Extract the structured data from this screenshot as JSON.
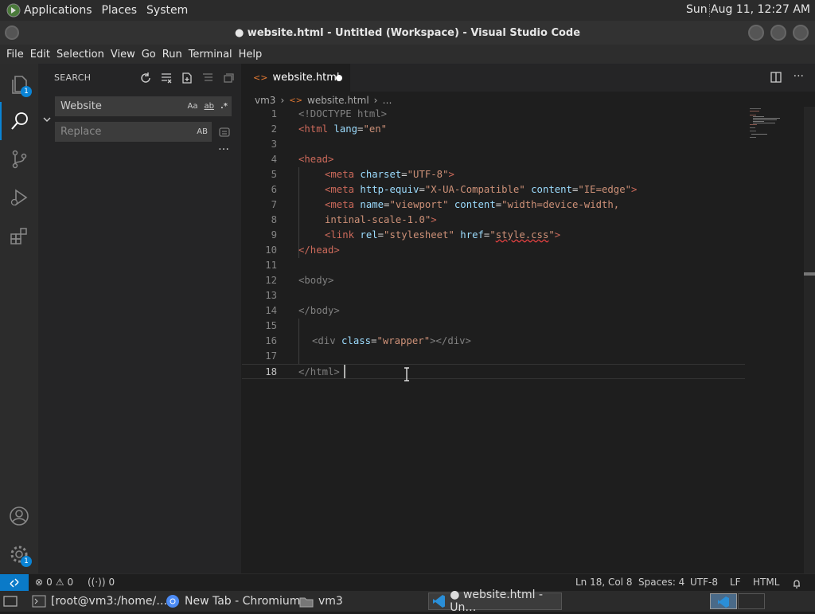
{
  "topbar": {
    "applications": "Applications",
    "places": "Places",
    "system": "System",
    "clock": "Sun Aug 11, 12:27 AM"
  },
  "window": {
    "title": "● website.html - Untitled (Workspace) - Visual Studio Code"
  },
  "menu": [
    "File",
    "Edit",
    "Selection",
    "View",
    "Go",
    "Run",
    "Terminal",
    "Help"
  ],
  "activity": {
    "explorer_badge": "1",
    "settings_badge": "1"
  },
  "sidebar": {
    "title": "SEARCH",
    "search_value": "Website",
    "replace_placeholder": "Replace",
    "opt_case": "Aa",
    "opt_word": "ab",
    "opt_regex": ".*",
    "opt_preserve": "AB",
    "more": "…"
  },
  "editor": {
    "tab_label": "website.html",
    "breadcrumb": [
      "vm3",
      "website.html",
      "…"
    ],
    "lines": [
      {
        "n": "1"
      },
      {
        "n": "2"
      },
      {
        "n": "3"
      },
      {
        "n": "4"
      },
      {
        "n": "5"
      },
      {
        "n": "6"
      },
      {
        "n": "7"
      },
      {
        "n": "8"
      },
      {
        "n": "9"
      },
      {
        "n": "10"
      },
      {
        "n": "11"
      },
      {
        "n": "12"
      },
      {
        "n": "13"
      },
      {
        "n": "14"
      },
      {
        "n": "15"
      },
      {
        "n": "16"
      },
      {
        "n": "17"
      },
      {
        "n": "18"
      }
    ],
    "code": {
      "l1": "<!DOCTYPE html>",
      "l2a": "<html ",
      "l2b": "lang",
      "l2c": "=",
      "l2d": "\"en\"",
      "l4": "<head>",
      "l5a": "<meta ",
      "l5b": "charset",
      "l5c": "=",
      "l5d": "\"UTF-8\"",
      "l5e": ">",
      "l6a": "<meta ",
      "l6b": "http-equiv",
      "l6c": "=",
      "l6d": "\"X-UA-Compatible\"",
      "l6e": " content",
      "l6f": "=",
      "l6g": "\"IE=edge\"",
      "l6h": ">",
      "l7a": "<meta ",
      "l7b": "name",
      "l7c": "=",
      "l7d": "\"viewport\"",
      "l7e": " content",
      "l7f": "=",
      "l7g": "\"width=device-width,",
      "l8a": "intinal-scale-1.0\"",
      "l8b": ">",
      "l9a": "<link ",
      "l9b": "rel",
      "l9c": "=",
      "l9d": "\"stylesheet\"",
      "l9e": " href",
      "l9f": "=",
      "l9g": "\"",
      "l9h": "style.css",
      "l9i": "\"",
      "l9j": ">",
      "l10": "</head>",
      "l12": "<body>",
      "l14": "</body>",
      "l16a": "<div ",
      "l16b": "class",
      "l16c": "=",
      "l16d": "\"wrapper\"",
      "l16e": "></div>",
      "l18": "</html>"
    }
  },
  "status": {
    "errors": "0",
    "warnings": "0",
    "ports": "0",
    "position": "Ln 18, Col 8",
    "spaces": "Spaces: 4",
    "encoding": "UTF-8",
    "eol": "LF",
    "language": "HTML"
  },
  "taskbar": {
    "terminal": "[root@vm3:/home/…",
    "chromium": "New Tab - Chromium",
    "files": "vm3",
    "vscode": "● website.html - Un…"
  }
}
